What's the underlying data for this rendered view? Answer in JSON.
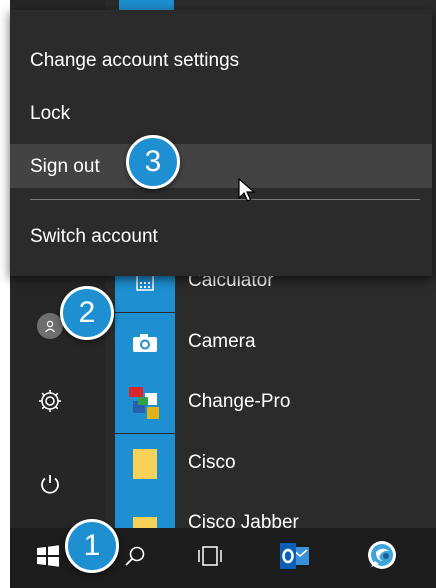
{
  "account_menu": {
    "items": [
      {
        "label": "Change account settings"
      },
      {
        "label": "Lock"
      },
      {
        "label": "Sign out"
      },
      {
        "label": "Switch account"
      }
    ],
    "hovered_item": "Sign out"
  },
  "apps": [
    {
      "label": "Calculator",
      "icon": "calculator-icon",
      "tile_color": "#1e8fd1"
    },
    {
      "label": "Camera",
      "icon": "camera-icon",
      "tile_color": "#1e8fd1"
    },
    {
      "label": "Change-Pro",
      "icon": "change-pro-icon",
      "tile_color": "#1e8fd1"
    },
    {
      "label": "Cisco",
      "icon": "folder-icon",
      "tile_color": "#1e8fd1"
    },
    {
      "label": "Cisco Jabber",
      "icon": "folder-icon",
      "tile_color": "#1e8fd1"
    }
  ],
  "left_rail": {
    "icons": [
      "user-icon",
      "gear-icon",
      "power-icon"
    ]
  },
  "taskbar": {
    "icons": [
      "windows-start-icon",
      "search-icon",
      "task-view-icon",
      "outlook-icon",
      "jabber-icon"
    ]
  },
  "callouts": {
    "one": "1",
    "two": "2",
    "three": "3"
  },
  "colors": {
    "accent": "#1e8fd1",
    "menu_bg": "#2b2b2b",
    "hover_bg": "#434343"
  }
}
